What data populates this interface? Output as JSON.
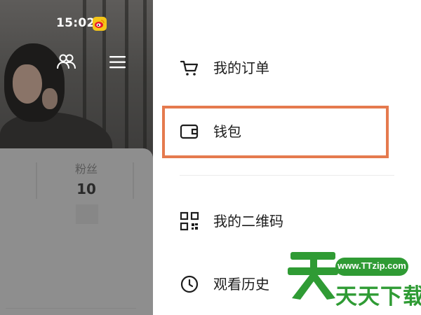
{
  "status_bar": {
    "time": "15:02"
  },
  "profile": {
    "stat_label": "粉丝",
    "stat_value": "10"
  },
  "drawer": {
    "items": [
      {
        "label": "我的订单",
        "icon": "cart-icon"
      },
      {
        "label": "钱包",
        "icon": "wallet-icon"
      },
      {
        "label": "我的二维码",
        "icon": "qr-code-icon"
      },
      {
        "label": "观看历史",
        "icon": "clock-icon"
      }
    ],
    "highlighted_item": "钱包"
  },
  "watermark": {
    "url": "www.TTzip.com",
    "text": "天天下载"
  },
  "colors": {
    "highlight_border": "#e57a4e",
    "watermark_green": "#2f9b34",
    "overlay_gray": "#8e8e8e"
  }
}
